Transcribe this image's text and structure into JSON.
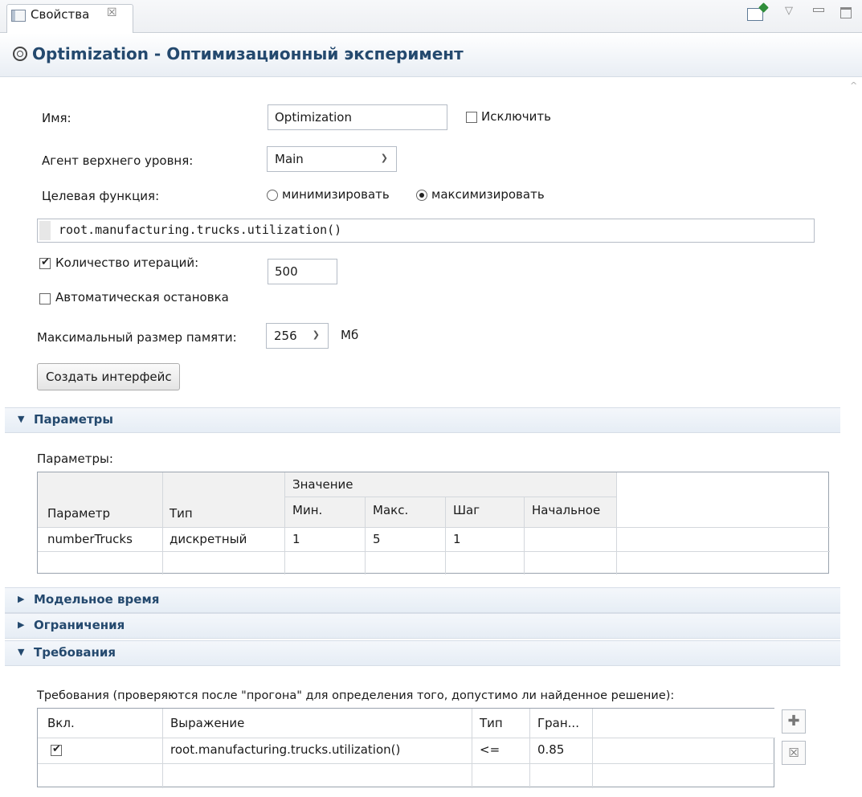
{
  "tab": {
    "label": "Свойства",
    "close": "☒"
  },
  "header": {
    "title": "Optimization - Оптимизационный эксперимент"
  },
  "form": {
    "name_label": "Имя:",
    "name_value": "Optimization",
    "exclude_label": "Исключить",
    "agent_label": "Агент верхнего уровня:",
    "agent_value": "Main",
    "objective_label": "Целевая функция:",
    "minimize_label": "минимизировать",
    "maximize_label": "максимизировать",
    "objective_expression": "root.manufacturing.trucks.utilization()",
    "iterations_label": "Количество итераций:",
    "iterations_checked": true,
    "iterations_value": "500",
    "autostop_label": "Автоматическая остановка",
    "autostop_checked": false,
    "memory_label": "Максимальный размер памяти:",
    "memory_value": "256",
    "memory_unit": "Мб",
    "create_ui_button": "Создать интерфейс"
  },
  "sections": {
    "parameters": "Параметры",
    "model_time": "Модельное время",
    "constraints": "Ограничения",
    "requirements": "Требования"
  },
  "parameters": {
    "caption": "Параметры:",
    "group_header": "Значение",
    "columns": [
      "Параметр",
      "Тип",
      "Мин.",
      "Макс.",
      "Шаг",
      "Начальное"
    ],
    "rows": [
      [
        "numberTrucks",
        "дискретный",
        "1",
        "5",
        "1",
        ""
      ]
    ]
  },
  "requirements": {
    "caption": "Требования (проверяются после \"прогона\" для определения того, допустимо ли найденное решение):",
    "columns": [
      "Вкл.",
      "Выражение",
      "Тип",
      "Гран..."
    ],
    "rows": [
      {
        "enabled": true,
        "expression": "root.manufacturing.trucks.utilization()",
        "type": "<=",
        "bound": "0.85"
      }
    ]
  }
}
